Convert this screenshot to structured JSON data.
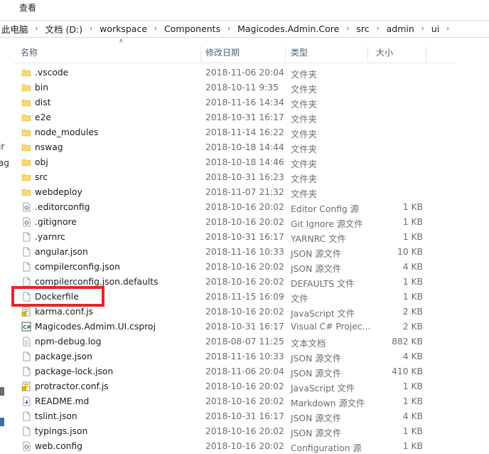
{
  "ribbon": {
    "tab_view": "查看"
  },
  "breadcrumb": [
    "此电脑",
    "文档 (D:)",
    "workspace",
    "Components",
    "Magicodes.Admin.Core",
    "src",
    "admin",
    "ui"
  ],
  "navpane_cut": [
    "ir",
    "ag"
  ],
  "columns": {
    "name": "名称",
    "date": "修改日期",
    "type": "类型",
    "size": "大小"
  },
  "files": [
    {
      "name": ".vscode",
      "date": "2018-11-06 20:04",
      "type": "文件夹",
      "size": "",
      "icon": "folder-icon"
    },
    {
      "name": "bin",
      "date": "2018-10-11 9:35",
      "type": "文件夹",
      "size": "",
      "icon": "folder-icon"
    },
    {
      "name": "dist",
      "date": "2018-11-16 14:34",
      "type": "文件夹",
      "size": "",
      "icon": "folder-icon"
    },
    {
      "name": "e2e",
      "date": "2018-10-31 16:17",
      "type": "文件夹",
      "size": "",
      "icon": "folder-icon"
    },
    {
      "name": "node_modules",
      "date": "2018-11-14 16:22",
      "type": "文件夹",
      "size": "",
      "icon": "folder-icon"
    },
    {
      "name": "nswag",
      "date": "2018-10-18 14:44",
      "type": "文件夹",
      "size": "",
      "icon": "folder-icon"
    },
    {
      "name": "obj",
      "date": "2018-10-18 14:46",
      "type": "文件夹",
      "size": "",
      "icon": "folder-icon"
    },
    {
      "name": "src",
      "date": "2018-10-31 16:23",
      "type": "文件夹",
      "size": "",
      "icon": "folder-icon"
    },
    {
      "name": "webdeploy",
      "date": "2018-11-07 21:32",
      "type": "文件夹",
      "size": "",
      "icon": "folder-icon"
    },
    {
      "name": ".editorconfig",
      "date": "2018-10-16 20:02",
      "type": "Editor Config 源",
      "size": "1 KB",
      "icon": "gear-file-icon"
    },
    {
      "name": ".gitignore",
      "date": "2018-10-16 20:02",
      "type": "Git Ignore 源文件",
      "size": "1 KB",
      "icon": "gear-file-icon"
    },
    {
      "name": ".yarnrc",
      "date": "2018-10-31 16:17",
      "type": "YARNRC 文件",
      "size": "1 KB",
      "icon": "file-icon"
    },
    {
      "name": "angular.json",
      "date": "2018-11-16 10:33",
      "type": "JSON 源文件",
      "size": "10 KB",
      "icon": "file-icon"
    },
    {
      "name": "compilerconfig.json",
      "date": "2018-10-16 20:02",
      "type": "JSON 源文件",
      "size": "4 KB",
      "icon": "file-icon"
    },
    {
      "name": "compilerconfig.json.defaults",
      "date": "2018-10-16 20:02",
      "type": "DEFAULTS 文件",
      "size": "1 KB",
      "icon": "file-icon"
    },
    {
      "name": "Dockerfile",
      "date": "2018-11-15 16:09",
      "type": "文件",
      "size": "1 KB",
      "icon": "file-icon"
    },
    {
      "name": "karma.conf.js",
      "date": "2018-10-16 20:02",
      "type": "JavaScript 文件",
      "size": "2 KB",
      "icon": "script-file-icon"
    },
    {
      "name": "Magicodes.Admim.UI.csproj",
      "date": "2018-10-31 16:17",
      "type": "Visual C# Projec...",
      "size": "2 KB",
      "icon": "csharp-project-icon"
    },
    {
      "name": "npm-debug.log",
      "date": "2018-08-07 11:25",
      "type": "文本文档",
      "size": "882 KB",
      "icon": "text-file-icon"
    },
    {
      "name": "package.json",
      "date": "2018-11-16 10:33",
      "type": "JSON 源文件",
      "size": "4 KB",
      "icon": "file-icon"
    },
    {
      "name": "package-lock.json",
      "date": "2018-11-06 20:04",
      "type": "JSON 源文件",
      "size": "410 KB",
      "icon": "file-icon"
    },
    {
      "name": "protractor.conf.js",
      "date": "2018-10-16 20:02",
      "type": "JavaScript 文件",
      "size": "1 KB",
      "icon": "script-file-icon"
    },
    {
      "name": "README.md",
      "date": "2018-10-16 20:02",
      "type": "Markdown 源文件",
      "size": "1 KB",
      "icon": "markdown-file-icon"
    },
    {
      "name": "tslint.json",
      "date": "2018-10-31 16:17",
      "type": "JSON 源文件",
      "size": "4 KB",
      "icon": "file-icon"
    },
    {
      "name": "typings.json",
      "date": "2018-10-16 20:02",
      "type": "JSON 源文件",
      "size": "1 KB",
      "icon": "file-icon"
    },
    {
      "name": "web.config",
      "date": "2018-10-16 20:02",
      "type": "Configuration 源",
      "size": "1 KB",
      "icon": "gear-file-icon"
    }
  ],
  "colors": {
    "folder": "#f8d775",
    "highlight": "#e8242b",
    "header_text": "#4c607a"
  }
}
